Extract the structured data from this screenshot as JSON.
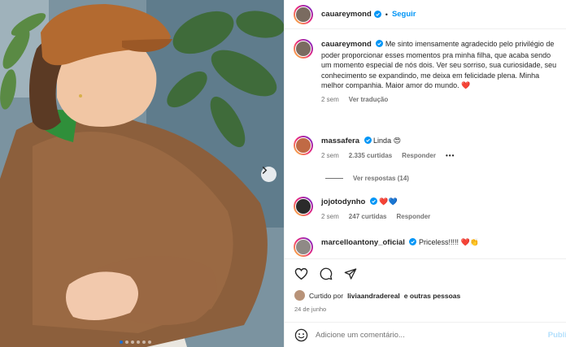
{
  "post": {
    "author": "cauareymond",
    "follow_label": "Seguir",
    "separator": "•",
    "caption": "Me sinto imensamente agradecido pelo privilégio de poder proporcionar esses momentos pra minha filha, que acaba sendo um momento especial de nós dois. Ver seu sorriso, sua curiosidade, seu conhecimento se expandindo, me deixa em felicidade plena. Minha melhor companhia. Maior amor do mundo. ❤️",
    "caption_time": "2 sem",
    "translate_label": "Ver tradução",
    "carousel": {
      "slides": 6,
      "active_index": 0
    }
  },
  "comments": [
    {
      "user": "massafera",
      "text": "Linda 😍",
      "time": "2 sem",
      "likes": "2.335 curtidas",
      "reply_label": "Responder",
      "more": "•••"
    },
    {
      "user": "jojotodynho",
      "text": "❤️💙",
      "time": "2 sem",
      "likes": "247 curtidas",
      "reply_label": "Responder"
    },
    {
      "user": "marcelloantony_oficial",
      "text": "Priceless!!!!! ❤️👏"
    }
  ],
  "view_replies_label": "Ver respostas (14)",
  "liked_by": {
    "prefix": "Curtido por",
    "user": "liviaandradereal",
    "suffix": "e outras pessoas"
  },
  "date": "24 de junho",
  "composer": {
    "placeholder": "Adicione um comentário...",
    "publish_label": "Publi"
  },
  "icons": {
    "like": "heart-icon",
    "comment": "comment-icon",
    "share": "share-icon",
    "emoji": "emoji-icon",
    "verified": "verified-badge-icon",
    "next": "chevron-right-icon"
  },
  "colors": {
    "accent": "#0095f6",
    "muted": "#737373",
    "heart": "#ed4956"
  }
}
